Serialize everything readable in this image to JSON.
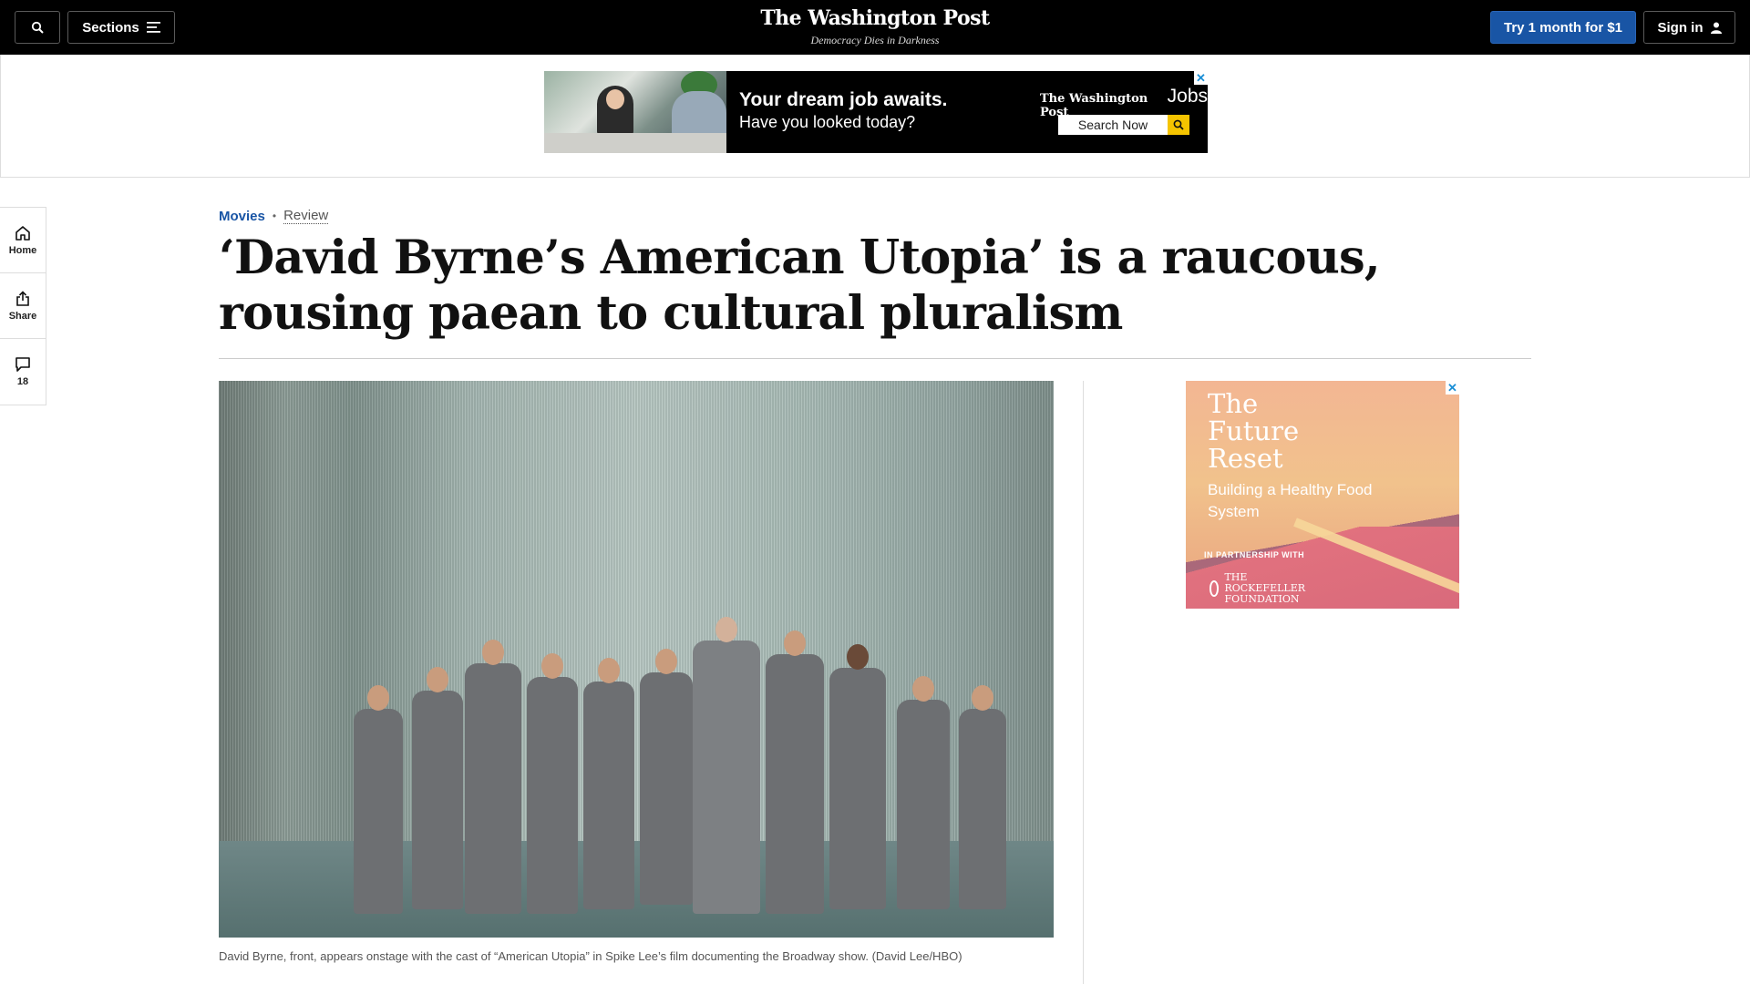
{
  "nav": {
    "sections_label": "Sections",
    "logo": "The Washington Post",
    "tagline": "Democracy Dies in Darkness",
    "try_label": "Try 1 month for $1",
    "signin_label": "Sign in"
  },
  "top_ad": {
    "headline": "Your dream job awaits.",
    "subline": "Have you looked today?",
    "brand_logo": "The Washington Post",
    "brand_jobs": "Jobs",
    "search_label": "Search Now",
    "close": "✕"
  },
  "left_rail": {
    "home_label": "Home",
    "share_label": "Share",
    "comments_count": "18"
  },
  "article": {
    "section": "Movies",
    "label": "Review",
    "headline": "‘David Byrne’s American Utopia’ is a raucous, rousing paean to cultural pluralism",
    "caption": "David Byrne, front, appears onstage with the cast of “American Utopia” in Spike Lee’s film documenting the Broadway show. (David Lee/HBO)"
  },
  "side_ad": {
    "title": "The Future Reset",
    "subtitle": "Building a Healthy Food System",
    "partner_label": "IN PARTNERSHIP WITH",
    "partner_name": "THE ROCKEFELLER FOUNDATION",
    "close": "✕"
  },
  "colors": {
    "accent": "#1955a5",
    "nav_bg": "#000000"
  }
}
